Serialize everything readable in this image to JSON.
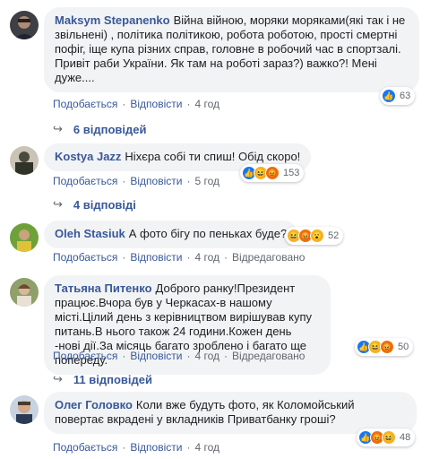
{
  "comments": [
    {
      "author": "Maksym Stepanenko",
      "text": "Війна війною, моряки моряками(які так і не звільнені) , політика політикою, робота роботою, прості смертні пофіг, іще купа різних справ, головне в робочий час в спортзалі. Привіт раби України. Як там на роботі зараз?) важко?! Мені дуже....",
      "reaction_count": "63",
      "like_label": "Подобається",
      "reply_label": "Відповісти",
      "time": "4 год",
      "replies_label": "6 відповідей"
    },
    {
      "author": "Kostya Jazz",
      "text": "Ніхєра собі ти спиш! Обід скоро!",
      "reaction_count": "153",
      "like_label": "Подобається",
      "reply_label": "Відповісти",
      "time": "5 год",
      "replies_label": "4 відповіді"
    },
    {
      "author": "Oleh Stasiuk",
      "text": "А фото бігу по пеньках буде?",
      "reaction_count": "52",
      "like_label": "Подобається",
      "reply_label": "Відповісти",
      "time": "4 год",
      "edited_label": "Відредаговано"
    },
    {
      "author": "Татьяна Питенко",
      "text": "Доброго ранку!Президент працює.Вчора був у Черкасах-в нашому місті.Цілий день з керівництвом вирішував купу питань.В нього також 24 години.Кожен день -нові дії.За місяць багато зроблено і багато ще попереду.",
      "reaction_count": "50",
      "like_label": "Подобається",
      "reply_label": "Відповісти",
      "time": "4 год",
      "edited_label": "Відредаговано",
      "replies_label": "11 відповідей"
    },
    {
      "author": "Олег Головко",
      "text": "Коли вже будуть фото, як Коломойський повертає вкрадені у вкладників Приватбанку гроші?",
      "reaction_count": "48",
      "like_label": "Подобається",
      "reply_label": "Відповісти",
      "time": "4 год"
    }
  ],
  "colors": {
    "link": "#385898",
    "bubble": "#f2f3f5",
    "like": "#1877f2",
    "haha": "#f7b125",
    "angry": "#e9710f"
  }
}
